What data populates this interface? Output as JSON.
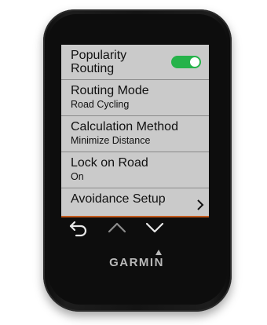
{
  "device": {
    "brand": "GARMIN"
  },
  "settings": {
    "items": [
      {
        "title": "Popularity Routing",
        "value": "",
        "toggle": true
      },
      {
        "title": "Routing Mode",
        "value": "Road Cycling"
      },
      {
        "title": "Calculation Method",
        "value": "Minimize Distance"
      },
      {
        "title": "Lock on Road",
        "value": "On"
      },
      {
        "title": "Avoidance Setup",
        "value": ""
      }
    ]
  },
  "icons": {
    "toggle": "toggle-on-icon",
    "avoidance_chevron": "chevron-right-icon",
    "back": "back-arrow-icon",
    "up": "chevron-up-icon",
    "down": "chevron-down-icon",
    "brand_mark": "garmin-triangle-icon"
  },
  "colors": {
    "toggle_on": "#26b34a",
    "accent_line": "#c25a1c",
    "screen_bg": "#c8c8c8"
  }
}
